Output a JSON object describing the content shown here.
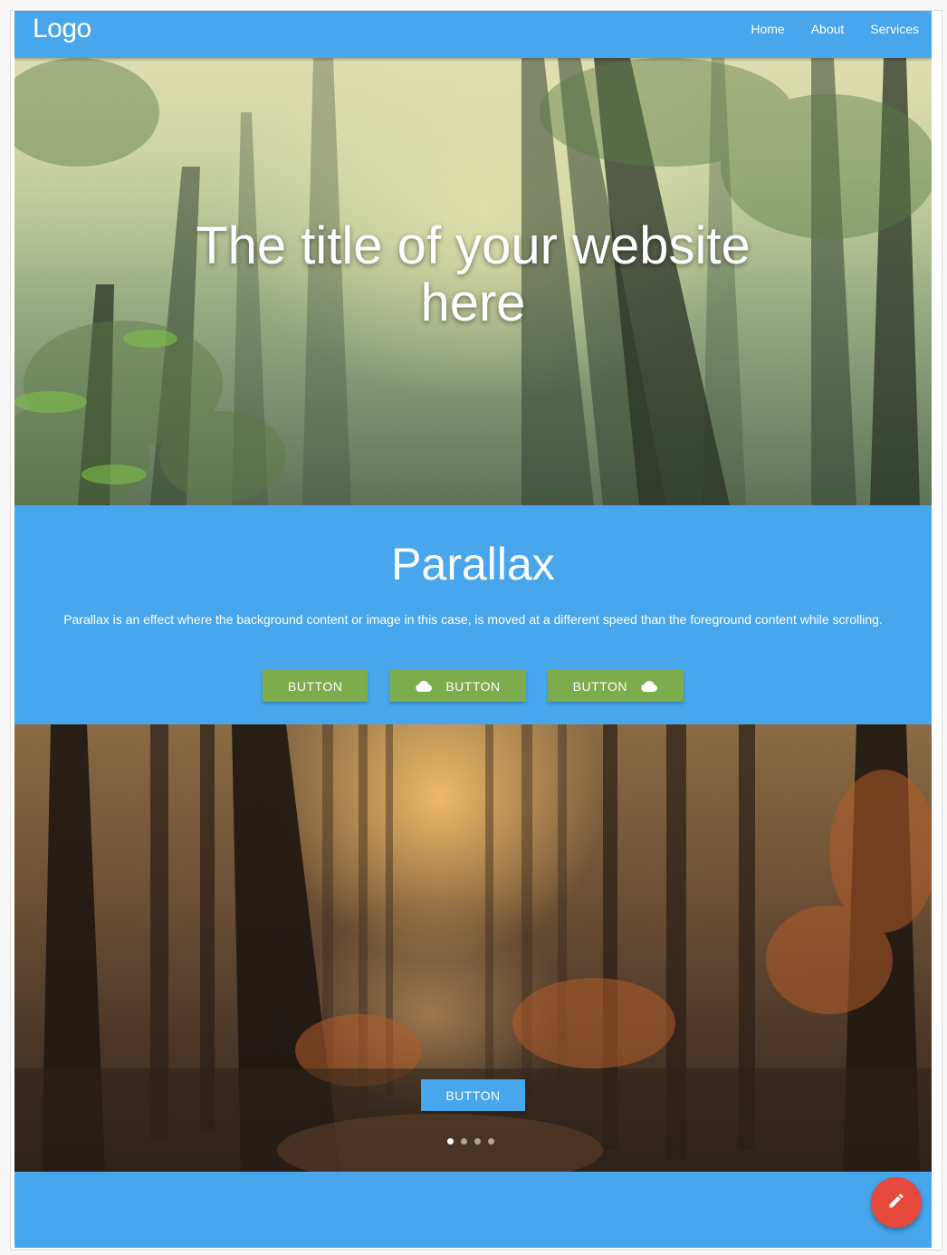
{
  "navbar": {
    "logo": "Logo",
    "links": [
      "Home",
      "About",
      "Services"
    ]
  },
  "hero": {
    "title_line1": "The title of your website",
    "title_line2": "here"
  },
  "intro": {
    "heading": "Parallax",
    "text": "Parallax is an effect where the background content or image in this case, is moved at a different speed than the foreground content while scrolling.",
    "buttons": [
      {
        "label": "BUTTON",
        "icon": null
      },
      {
        "label": "BUTTON",
        "icon": "cloud-icon",
        "icon_position": "left"
      },
      {
        "label": "BUTTON",
        "icon": "cloud-icon",
        "icon_position": "right"
      }
    ]
  },
  "slider": {
    "button_label": "BUTTON",
    "slide_count": 4,
    "active_slide": 1
  },
  "fab": {
    "icon": "edit-pencil-icon"
  },
  "colors": {
    "primary": "#48a6ec",
    "button_green": "#7cac4b",
    "fab_red": "#e64a3c",
    "text": "#ffffff"
  }
}
